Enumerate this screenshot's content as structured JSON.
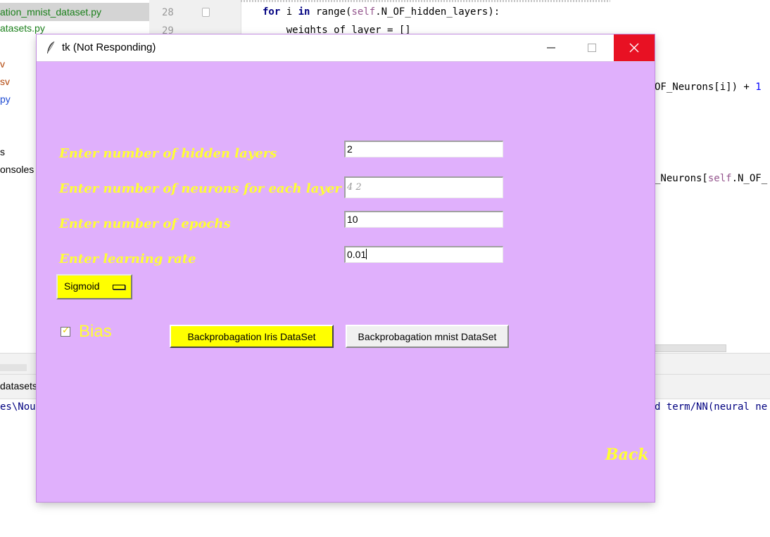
{
  "ide": {
    "project_items": [
      {
        "label": "ation_mnist_dataset.py",
        "color": "#1a7f1a"
      },
      {
        "label": "atasets.py",
        "color": "#1a7f1a"
      },
      {
        "label": "v",
        "color": "#b2460a"
      },
      {
        "label": "sv",
        "color": "#b2460a"
      },
      {
        "label": "py",
        "color": "#1e4bd2"
      },
      {
        "label": "s",
        "color": "#000000"
      },
      {
        "label": "onsoles",
        "color": "#000000"
      }
    ],
    "line_numbers": [
      "28",
      "29"
    ],
    "code_line_1": {
      "kw1": "for",
      "var": " i ",
      "kw2": "in",
      "rest1": " range(",
      "self": "self",
      "rest2": ".N_OF_hidden_layers):"
    },
    "code_line_2": "    weights_of_layer = []",
    "code_right_1": {
      "text": "OF_Neurons[i]) + ",
      "num": "1"
    },
    "code_right_2": {
      "pre": "_Neurons[",
      "self": "self",
      "post": ".N_OF_"
    },
    "run_tab_label": "datasets",
    "console_left": "es\\Nour",
    "console_right": "d term/NN(neural ne"
  },
  "window": {
    "title": "tk (Not Responding)",
    "minimize_label": "—",
    "close_label": "✕",
    "background_color": "#e0b0fc",
    "label_color": "#ffff33"
  },
  "form": {
    "hidden_layers_label": "Enter number of hidden layers",
    "neurons_label": "Enter number of neurons for each layer",
    "epochs_label": "Enter number of epochs",
    "learning_rate_label": "Enter learning rate",
    "hidden_layers_value": "2",
    "neurons_value": "4 2",
    "epochs_value": "10",
    "learning_rate_value": "0.01",
    "activation_selected": "Sigmoid",
    "bias_label": "Bias",
    "bias_checked": true,
    "iris_button": "Backprobagation Iris DataSet",
    "mnist_button": "Backprobagation mnist DataSet",
    "back_label": "Back"
  }
}
